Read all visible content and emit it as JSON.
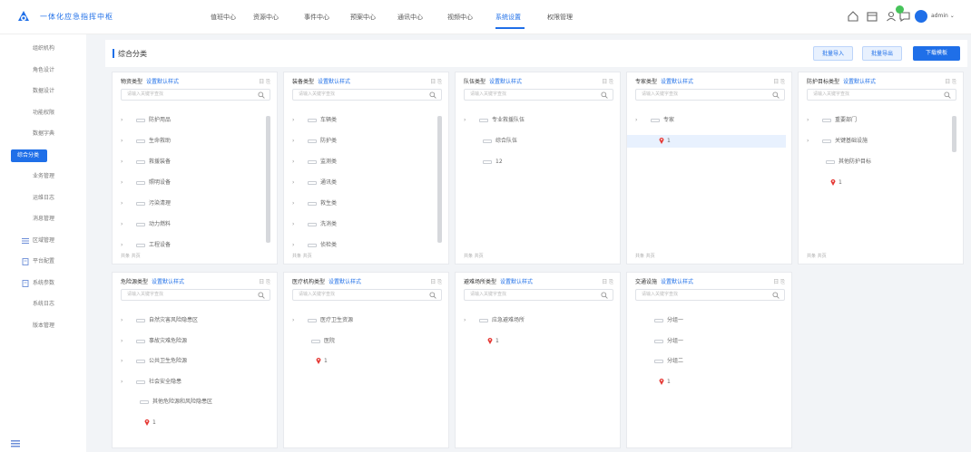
{
  "app": {
    "title": "一体化应急指挥中枢"
  },
  "nav": [
    {
      "label": "值班中心",
      "active": false
    },
    {
      "label": "资源中心",
      "active": false
    },
    {
      "label": "事件中心",
      "active": false
    },
    {
      "label": "预案中心",
      "active": false
    },
    {
      "label": "通讯中心",
      "active": false
    },
    {
      "label": "视频中心",
      "active": false
    },
    {
      "label": "系统设置",
      "active": true
    },
    {
      "label": "权限管理",
      "active": false
    }
  ],
  "user": {
    "name": "admin"
  },
  "colors": {
    "accent": "#1f6fe8",
    "badge": "#46c35a",
    "pin": "#e53935"
  },
  "sidebar": {
    "items": [
      {
        "label": "组织机构",
        "icon": null,
        "active": false
      },
      {
        "label": "角色设计",
        "icon": null,
        "active": false
      },
      {
        "label": "数据设计",
        "icon": null,
        "active": false
      },
      {
        "label": "功能权限",
        "icon": null,
        "active": false
      },
      {
        "label": "数据字典",
        "icon": null,
        "active": false
      },
      {
        "label": "综合分类",
        "icon": null,
        "active": true
      },
      {
        "label": "业务管理",
        "icon": null,
        "active": false
      },
      {
        "label": "运维日志",
        "icon": null,
        "active": false
      },
      {
        "label": "消息管理",
        "icon": null,
        "active": false
      },
      {
        "label": "区域管理",
        "icon": "list-icon",
        "active": false
      },
      {
        "label": "平台配置",
        "icon": "document-icon",
        "active": false
      },
      {
        "label": "系统参数",
        "icon": "document-icon",
        "active": false
      },
      {
        "label": "系统日志",
        "icon": null,
        "active": false
      },
      {
        "label": "版本管理",
        "icon": null,
        "active": false
      }
    ]
  },
  "page": {
    "title": "综合分类",
    "actions": {
      "import": "批量导入",
      "export": "批量导出",
      "download": "下载模板"
    }
  },
  "cards": [
    {
      "title": "物资类型",
      "link": "设置默认样式",
      "ops": "日 ⎘",
      "search_placeholder": "请输入关键字查找",
      "rows": [
        {
          "label": "防护用品",
          "caret": "›"
        },
        {
          "label": "生命救助",
          "caret": "›"
        },
        {
          "label": "救援装备",
          "caret": "›"
        },
        {
          "label": "照明设备",
          "caret": "›"
        },
        {
          "label": "污染清理",
          "caret": "›"
        },
        {
          "label": "动力燃料",
          "caret": "›"
        },
        {
          "label": "工程设备",
          "caret": "›"
        }
      ],
      "footer": "共条 共页"
    },
    {
      "title": "装备类型",
      "link": "设置默认样式",
      "ops": "日 ⎘",
      "search_placeholder": "请输入关键字查找",
      "rows": [
        {
          "label": "车辆类",
          "caret": "›"
        },
        {
          "label": "防护类",
          "caret": "›"
        },
        {
          "label": "监测类",
          "caret": "›"
        },
        {
          "label": "通讯类",
          "caret": "›"
        },
        {
          "label": "救生类",
          "caret": "›"
        },
        {
          "label": "洗消类",
          "caret": "›"
        },
        {
          "label": "侦检类",
          "caret": "›"
        }
      ],
      "footer": "共条 共页"
    },
    {
      "title": "队伍类型",
      "link": "设置默认样式",
      "ops": "日 ⎘",
      "search_placeholder": "请输入关键字查找",
      "rows": [
        {
          "label": "专业救援队伍",
          "caret": "›"
        },
        {
          "label": "综合队伍",
          "caret": ""
        },
        {
          "label": "12",
          "caret": ""
        }
      ],
      "footer": "共条 共页"
    },
    {
      "title": "专家类型",
      "link": "设置默认样式",
      "ops": "日 ⎘",
      "search_placeholder": "请输入关键字查找",
      "rows": [
        {
          "label": "专家",
          "caret": "›"
        },
        {
          "label": "1",
          "caret": "",
          "pin": true,
          "selected": true
        }
      ],
      "footer": "共条 共页"
    },
    {
      "title": "防护目标类型",
      "link": "设置默认样式",
      "ops": "日 ⎘",
      "search_placeholder": "请输入关键字查找",
      "rows": [
        {
          "label": "重要部门",
          "caret": "›"
        },
        {
          "label": "关键基础设施",
          "caret": "›"
        },
        {
          "label": "其他防护目标",
          "caret": ""
        },
        {
          "label": "1",
          "caret": "",
          "pin": true
        }
      ],
      "footer": "共条 共页"
    },
    {
      "title": "危险源类型",
      "link": "设置默认样式",
      "ops": "日 ⎘",
      "search_placeholder": "请输入关键字查找",
      "rows": [
        {
          "label": "自然灾害风险隐患区",
          "caret": "›"
        },
        {
          "label": "事故灾难危险源",
          "caret": "›"
        },
        {
          "label": "公共卫生危险源",
          "caret": "›"
        },
        {
          "label": "社会安全隐患",
          "caret": "›"
        },
        {
          "label": "其他危险源和风险隐患区",
          "caret": ""
        },
        {
          "label": "1",
          "caret": "",
          "pin": true
        }
      ],
      "footer": ""
    },
    {
      "title": "医疗机构类型",
      "link": "设置默认样式",
      "ops": "日 ⎘",
      "search_placeholder": "请输入关键字查找",
      "rows": [
        {
          "label": "医疗卫生资源",
          "caret": "›"
        },
        {
          "label": "医院",
          "caret": ""
        },
        {
          "label": "1",
          "caret": "",
          "pin": true
        }
      ],
      "footer": ""
    },
    {
      "title": "避难场所类型",
      "link": "设置默认样式",
      "ops": "日 ⎘",
      "search_placeholder": "请输入关键字查找",
      "rows": [
        {
          "label": "应急避难场所",
          "caret": "›"
        },
        {
          "label": "1",
          "caret": "",
          "pin": true
        }
      ],
      "footer": ""
    },
    {
      "title": "交通设施",
      "link": "设置默认样式",
      "ops": "日 ⎘",
      "search_placeholder": "请输入关键字查找",
      "rows": [
        {
          "label": "分组一",
          "caret": ""
        },
        {
          "label": "分组一",
          "caret": ""
        },
        {
          "label": "分组二",
          "caret": ""
        },
        {
          "label": "1",
          "caret": "",
          "pin": true
        }
      ],
      "footer": ""
    }
  ]
}
